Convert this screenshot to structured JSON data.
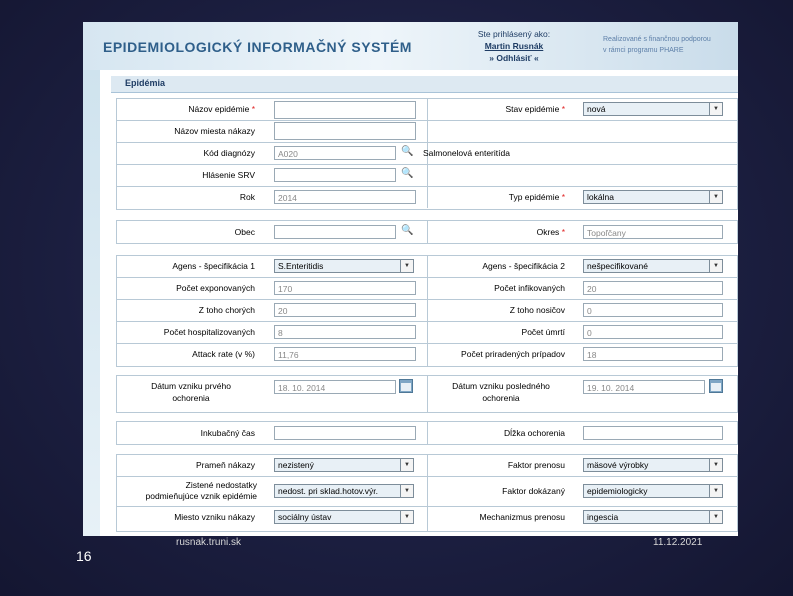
{
  "app": {
    "title": "EPIDEMIOLOGICKÝ INFORMAČNÝ SYSTÉM",
    "user_line1": "Ste prihlásený ako:",
    "user_name": "Martin Rusnák",
    "logout": "» Odhlásiť «",
    "phare_line1": "Realizované s finančnou podporou",
    "phare_line2": "v rámci programu PHARE"
  },
  "section": "Epidémia",
  "form": {
    "nazov_epidemie": {
      "label": "Názov epidémie",
      "required": "*",
      "value": ""
    },
    "stav_epidemie": {
      "label": "Stav epidémie",
      "required": "*",
      "value": "nová"
    },
    "nazov_miesta": {
      "label": "Názov miesta nákazy",
      "value": ""
    },
    "kod_diagnozy": {
      "label": "Kód diagnózy",
      "value": "A020",
      "desc": "Salmonelová enteritída"
    },
    "hlasenie_srv": {
      "label": "Hlásenie SRV",
      "value": ""
    },
    "rok": {
      "label": "Rok",
      "value": "2014"
    },
    "typ_epidemie": {
      "label": "Typ epidémie",
      "required": "*",
      "value": "lokálna"
    },
    "obec": {
      "label": "Obec",
      "value": ""
    },
    "okres": {
      "label": "Okres",
      "required": "*",
      "value": "Topoľčany"
    },
    "agens1": {
      "label": "Agens - špecifikácia 1",
      "value": "S.Enteritidis"
    },
    "agens2": {
      "label": "Agens - špecifikácia 2",
      "value": "nešpecifikované"
    },
    "pocet_exp": {
      "label": "Počet exponovaných",
      "value": "170"
    },
    "pocet_inf": {
      "label": "Počet infikovaných",
      "value": "20"
    },
    "z_toho_chorych": {
      "label": "Z toho chorých",
      "value": "20"
    },
    "z_toho_nosicov": {
      "label": "Z toho nosičov",
      "value": "0"
    },
    "pocet_hosp": {
      "label": "Počet hospitalizovaných",
      "value": "8"
    },
    "pocet_umrti": {
      "label": "Počet úmrtí",
      "value": "0"
    },
    "attack_rate": {
      "label": "Attack rate (v %)",
      "value": "11,76"
    },
    "pocet_prirad": {
      "label": "Počet priradených prípadov",
      "value": "18"
    },
    "datum_prveho_l1": "Dátum vzniku prvého",
    "datum_prveho_l2": "ochorenia",
    "datum_prveho_val": "18. 10. 2014",
    "datum_posl_l1": "Dátum vzniku posledného",
    "datum_posl_l2": "ochorenia",
    "datum_posl_val": "19. 10. 2014",
    "inkubacny_cas": {
      "label": "Inkubačný čas",
      "value": ""
    },
    "dlzka_ochorenia": {
      "label": "Dĺžka ochorenia",
      "value": ""
    },
    "pramen_nakazy": {
      "label": "Prameň nákazy",
      "value": "nezistený"
    },
    "faktor_prenosu": {
      "label": "Faktor prenosu",
      "value": "mäsové výrobky"
    },
    "zistene_l1": "Zistené nedostatky",
    "zistene_l2": "podmieňujúce vznik epidémie",
    "zistene_val": "nedost. pri sklad.hotov.výr.",
    "faktor_dokazany": {
      "label": "Faktor dokázaný",
      "value": "epidemiologicky"
    },
    "miesto_vzniku": {
      "label": "Miesto vzniku nákazy",
      "value": "sociálny ústav"
    },
    "mechanizmus": {
      "label": "Mechanizmus prenosu",
      "value": "ingescia"
    }
  },
  "footer": {
    "slide_number": "16",
    "website": "rusnak.truni.sk",
    "date": "11.12.2021"
  }
}
